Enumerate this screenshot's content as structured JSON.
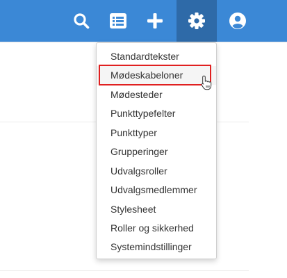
{
  "topbar": {
    "bg_color": "#3b88d6",
    "active_bg_color": "#2e6aa8",
    "buttons": [
      {
        "icon": "search-icon"
      },
      {
        "icon": "list-icon"
      },
      {
        "icon": "plus-icon"
      },
      {
        "icon": "gear-icon",
        "active": true
      },
      {
        "icon": "user-icon"
      }
    ]
  },
  "menu": {
    "items": [
      {
        "label": "Standardtekster"
      },
      {
        "label": "Mødeskabeloner",
        "hovered": true
      },
      {
        "label": "Mødesteder"
      },
      {
        "label": "Punkttypefelter"
      },
      {
        "label": "Punkttyper"
      },
      {
        "label": "Grupperinger"
      },
      {
        "label": "Udvalgsroller"
      },
      {
        "label": "Udvalgsmedlemmer"
      },
      {
        "label": "Stylesheet"
      },
      {
        "label": "Roller og sikkerhed"
      },
      {
        "label": "Systemindstillinger"
      }
    ]
  },
  "annotation": {
    "highlight_color": "#e02020"
  }
}
